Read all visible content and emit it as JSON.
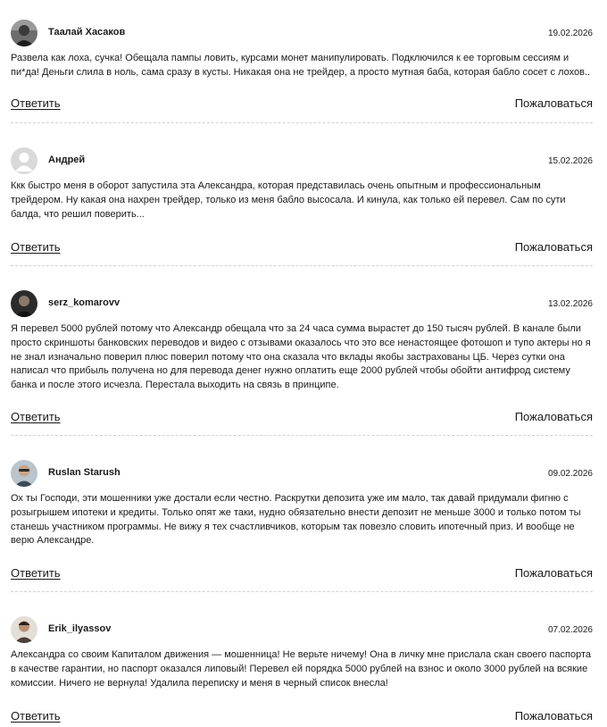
{
  "comments": [
    {
      "author": "Таалай Хасаков",
      "date": "19.02.2026",
      "avatar": "dark-photo-avatar",
      "text": "Развела как лоха, сучка! Обещала пампы ловить, курсами монет манипулировать. Подключился к ее торговым сессиям и пи*да! Деньги слила в ноль, сама сразу в кусты. Никакая она не трейдер, а просто мутная баба, которая бабло сосет с лохов..",
      "reply_label": "Ответить",
      "report_label": "Пожаловаться"
    },
    {
      "author": "Андрей",
      "date": "15.02.2026",
      "avatar": "default-user-avatar",
      "text": "Ккк быстро меня в оборот запустила эта Александра, которая представилась очень опытным и профессиональным трейдером. Ну какая она нахрен трейдер, только из меня бабло высосала. И кинула, как только ей перевел. Сам по сути балда, что решил поверить...",
      "reply_label": "Ответить",
      "report_label": "Пожаловаться"
    },
    {
      "author": "serz_komarovv",
      "date": "13.02.2026",
      "avatar": "dark-photo-avatar",
      "text": "Я перевел 5000 рублей потому что Александр обещала что за 24 часа сумма вырастет до 150 тысяч рублей. В канале были просто скриншоты банковских переводов и видео с отзывами оказалось что это все ненастоящее фотошоп и тупо актеры но я не знал изначально поверил плюс поверил потому что она сказала что вклады якобы застрахованы ЦБ. Через сутки она написал что прибыль получена но для перевода денег нужно оплатить еще 2000 рублей чтобы обойти антифрод систему банка и после этого исчезла. Перестала выходить на связь в принципе.",
      "reply_label": "Ответить",
      "report_label": "Пожаловаться"
    },
    {
      "author": "Ruslan Starush",
      "date": "09.02.2026",
      "avatar": "light-photo-avatar",
      "text": "Ох ты Господи, эти мошенники уже достали если честно. Раскрутки депозита уже им мало, так давай придумали фигню с розыгрышем ипотеки и кредиты. Только опят же таки, нудно обязательно внести депозит не меньше 3000 и только потом ты станешь участником программы. Не вижу я тех счастливчиков, которым так повезло словить ипотечный приз. И вообще не верю Александре.",
      "reply_label": "Ответить",
      "report_label": "Пожаловаться"
    },
    {
      "author": "Erik_ilyassov",
      "date": "07.02.2026",
      "avatar": "light-photo-avatar",
      "text": "Александра со своим Капиталом движения — мошенница! Не верьте ничему! Она в личку мне прислала скан своего паспорта в качестве гарантии, но паспорт оказался липовый! Перевел ей порядка 5000 рублей на взнос и около 3000 рублей на всякие комиссии. Ничего не вернула! Удалила переписку и меня в черный список внесла!",
      "reply_label": "Ответить",
      "report_label": "Пожаловаться"
    }
  ]
}
